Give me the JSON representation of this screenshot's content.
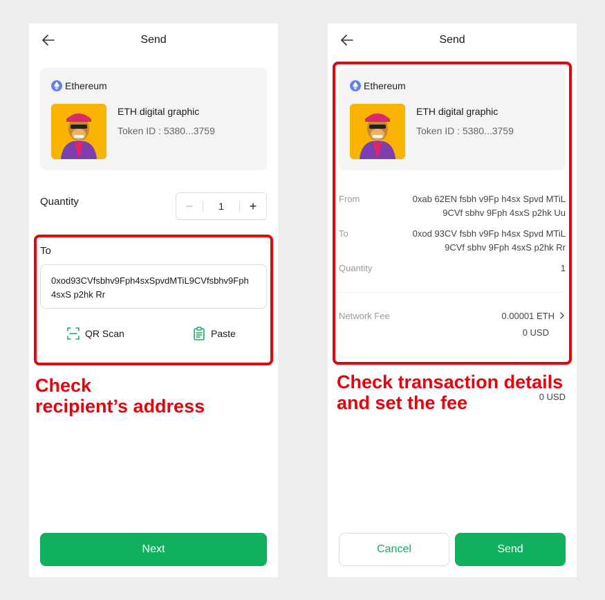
{
  "left_screen": {
    "title": "Send",
    "chain": "Ethereum",
    "nft_name": "ETH digital graphic",
    "token_id": "Token ID : 5380...3759",
    "quantity_label": "Quantity",
    "quantity_value": "1",
    "to_label": "To",
    "to_address": "0xod93CVfsbhv9Fph4sxSpvdMTiL9CVfsbhv9Fph 4sxS p2hk Rr",
    "qr_scan_label": "QR Scan",
    "paste_label": "Paste",
    "next_label": "Next",
    "annotation": "Check\nrecipient’s  address"
  },
  "right_screen": {
    "title": "Send",
    "chain": "Ethereum",
    "nft_name": "ETH digital graphic",
    "token_id": "Token ID : 5380...3759",
    "from_label": "From",
    "from_value": "0xab 62EN fsbh v9Fp h4sx Spvd MTiL 9CVf sbhv 9Fph 4sxS p2hk Uu",
    "to_label": "To",
    "to_value": "0xod 93CV fsbh v9Fp h4sx Spvd MTiL 9CVf sbhv 9Fph 4sxS p2hk Rr",
    "quantity_label": "Quantity",
    "quantity_value": "1",
    "network_fee_label": "Network Fee",
    "network_fee_eth": "0.00001 ETH",
    "network_fee_usd": "0 USD",
    "balance_usd": "0 USD",
    "cancel_label": "Cancel",
    "send_label": "Send",
    "annotation": "Check transaction details\nand set the fee"
  },
  "colors": {
    "accent_green": "#10b05e",
    "highlight_red": "#e8000b",
    "eth_blue": "#627eea"
  },
  "icons": [
    "back-arrow-icon",
    "ethereum-icon",
    "minus-icon",
    "plus-icon",
    "qr-scan-icon",
    "paste-icon",
    "chevron-right-icon"
  ]
}
